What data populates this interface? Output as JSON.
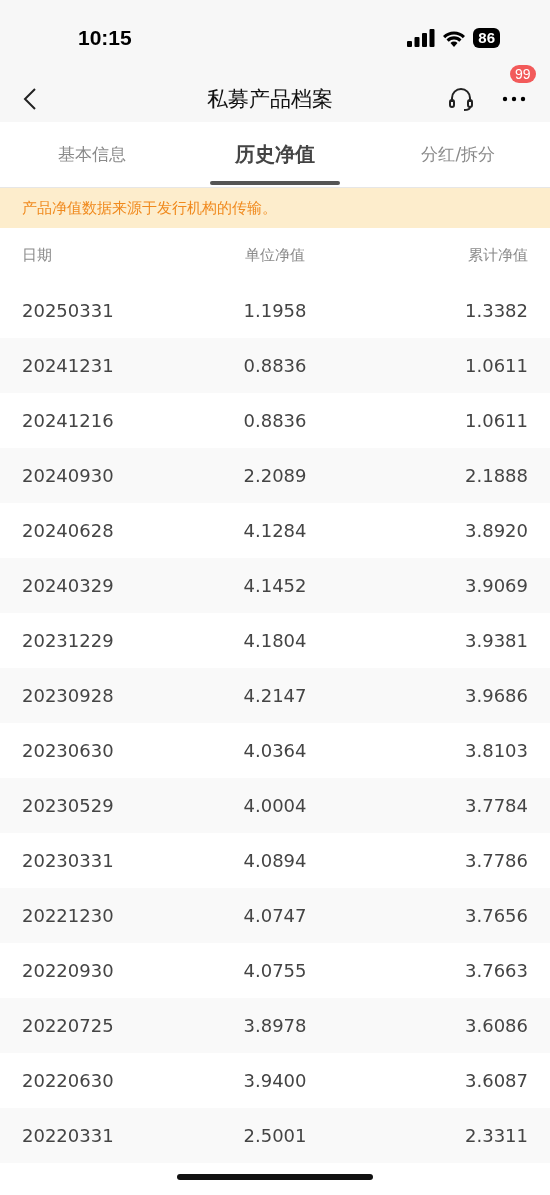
{
  "status_bar": {
    "time": "10:15",
    "battery": "86"
  },
  "nav": {
    "title": "私募产品档案",
    "badge": "99"
  },
  "tabs": [
    {
      "label": "基本信息",
      "selected": false
    },
    {
      "label": "历史净值",
      "selected": true
    },
    {
      "label": "分红/拆分",
      "selected": false
    }
  ],
  "notice": "产品净值数据来源于发行机构的传输。",
  "table": {
    "columns": [
      "日期",
      "单位净值",
      "累计净值"
    ],
    "rows": [
      [
        "20250331",
        "1.1958",
        "1.3382"
      ],
      [
        "20241231",
        "0.8836",
        "1.0611"
      ],
      [
        "20241216",
        "0.8836",
        "1.0611"
      ],
      [
        "20240930",
        "2.2089",
        "2.1888"
      ],
      [
        "20240628",
        "4.1284",
        "3.8920"
      ],
      [
        "20240329",
        "4.1452",
        "3.9069"
      ],
      [
        "20231229",
        "4.1804",
        "3.9381"
      ],
      [
        "20230928",
        "4.2147",
        "3.9686"
      ],
      [
        "20230630",
        "4.0364",
        "3.8103"
      ],
      [
        "20230529",
        "4.0004",
        "3.7784"
      ],
      [
        "20230331",
        "4.0894",
        "3.7786"
      ],
      [
        "20221230",
        "4.0747",
        "3.7656"
      ],
      [
        "20220930",
        "4.0755",
        "3.7663"
      ],
      [
        "20220725",
        "3.8978",
        "3.6086"
      ],
      [
        "20220630",
        "3.9400",
        "3.6087"
      ],
      [
        "20220331",
        "2.5001",
        "2.3311"
      ]
    ]
  }
}
